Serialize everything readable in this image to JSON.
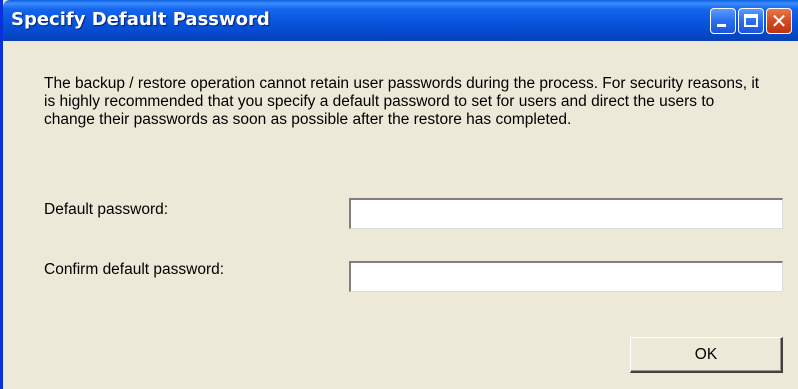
{
  "window": {
    "title": "Specify Default Password"
  },
  "description": "The backup / restore operation cannot retain user passwords during the process. For security reasons, it is highly recommended that you specify a default password to set for users and direct the users to change their passwords as soon as possible after the restore has completed.",
  "form": {
    "default_password_label": "Default password:",
    "default_password_value": "",
    "confirm_password_label": "Confirm default password:",
    "confirm_password_value": ""
  },
  "buttons": {
    "ok_label": "OK",
    "minimize_icon": "minimize-icon",
    "maximize_icon": "maximize-icon",
    "close_icon": "close-icon"
  },
  "colors": {
    "titlebar": "#0754dd",
    "window_bg": "#ece9d8",
    "close_button": "#d64a1e"
  }
}
